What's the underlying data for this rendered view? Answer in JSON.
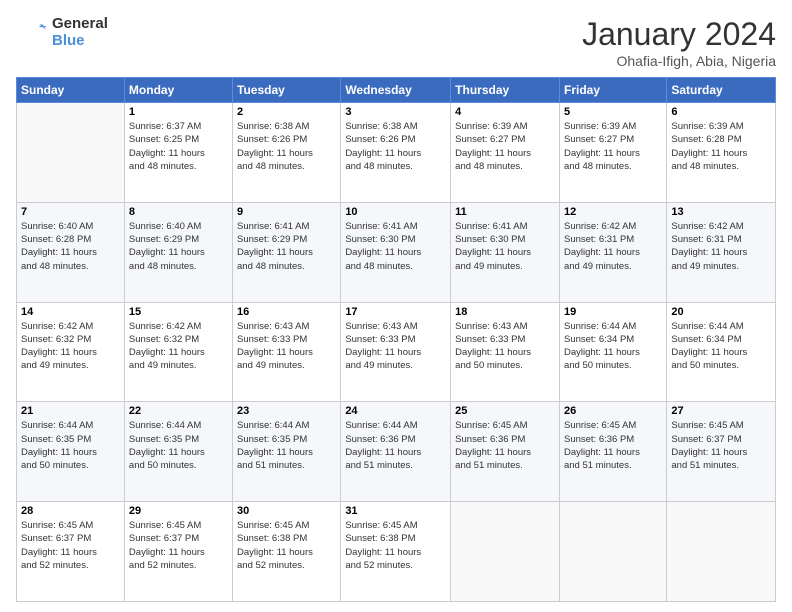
{
  "logo": {
    "text1": "General",
    "text2": "Blue"
  },
  "title": "January 2024",
  "subtitle": "Ohafia-Ifigh, Abia, Nigeria",
  "weekdays": [
    "Sunday",
    "Monday",
    "Tuesday",
    "Wednesday",
    "Thursday",
    "Friday",
    "Saturday"
  ],
  "weeks": [
    [
      {
        "day": "",
        "info": ""
      },
      {
        "day": "1",
        "info": "Sunrise: 6:37 AM\nSunset: 6:25 PM\nDaylight: 11 hours\nand 48 minutes."
      },
      {
        "day": "2",
        "info": "Sunrise: 6:38 AM\nSunset: 6:26 PM\nDaylight: 11 hours\nand 48 minutes."
      },
      {
        "day": "3",
        "info": "Sunrise: 6:38 AM\nSunset: 6:26 PM\nDaylight: 11 hours\nand 48 minutes."
      },
      {
        "day": "4",
        "info": "Sunrise: 6:39 AM\nSunset: 6:27 PM\nDaylight: 11 hours\nand 48 minutes."
      },
      {
        "day": "5",
        "info": "Sunrise: 6:39 AM\nSunset: 6:27 PM\nDaylight: 11 hours\nand 48 minutes."
      },
      {
        "day": "6",
        "info": "Sunrise: 6:39 AM\nSunset: 6:28 PM\nDaylight: 11 hours\nand 48 minutes."
      }
    ],
    [
      {
        "day": "7",
        "info": "Sunrise: 6:40 AM\nSunset: 6:28 PM\nDaylight: 11 hours\nand 48 minutes."
      },
      {
        "day": "8",
        "info": "Sunrise: 6:40 AM\nSunset: 6:29 PM\nDaylight: 11 hours\nand 48 minutes."
      },
      {
        "day": "9",
        "info": "Sunrise: 6:41 AM\nSunset: 6:29 PM\nDaylight: 11 hours\nand 48 minutes."
      },
      {
        "day": "10",
        "info": "Sunrise: 6:41 AM\nSunset: 6:30 PM\nDaylight: 11 hours\nand 48 minutes."
      },
      {
        "day": "11",
        "info": "Sunrise: 6:41 AM\nSunset: 6:30 PM\nDaylight: 11 hours\nand 49 minutes."
      },
      {
        "day": "12",
        "info": "Sunrise: 6:42 AM\nSunset: 6:31 PM\nDaylight: 11 hours\nand 49 minutes."
      },
      {
        "day": "13",
        "info": "Sunrise: 6:42 AM\nSunset: 6:31 PM\nDaylight: 11 hours\nand 49 minutes."
      }
    ],
    [
      {
        "day": "14",
        "info": "Sunrise: 6:42 AM\nSunset: 6:32 PM\nDaylight: 11 hours\nand 49 minutes."
      },
      {
        "day": "15",
        "info": "Sunrise: 6:42 AM\nSunset: 6:32 PM\nDaylight: 11 hours\nand 49 minutes."
      },
      {
        "day": "16",
        "info": "Sunrise: 6:43 AM\nSunset: 6:33 PM\nDaylight: 11 hours\nand 49 minutes."
      },
      {
        "day": "17",
        "info": "Sunrise: 6:43 AM\nSunset: 6:33 PM\nDaylight: 11 hours\nand 49 minutes."
      },
      {
        "day": "18",
        "info": "Sunrise: 6:43 AM\nSunset: 6:33 PM\nDaylight: 11 hours\nand 50 minutes."
      },
      {
        "day": "19",
        "info": "Sunrise: 6:44 AM\nSunset: 6:34 PM\nDaylight: 11 hours\nand 50 minutes."
      },
      {
        "day": "20",
        "info": "Sunrise: 6:44 AM\nSunset: 6:34 PM\nDaylight: 11 hours\nand 50 minutes."
      }
    ],
    [
      {
        "day": "21",
        "info": "Sunrise: 6:44 AM\nSunset: 6:35 PM\nDaylight: 11 hours\nand 50 minutes."
      },
      {
        "day": "22",
        "info": "Sunrise: 6:44 AM\nSunset: 6:35 PM\nDaylight: 11 hours\nand 50 minutes."
      },
      {
        "day": "23",
        "info": "Sunrise: 6:44 AM\nSunset: 6:35 PM\nDaylight: 11 hours\nand 51 minutes."
      },
      {
        "day": "24",
        "info": "Sunrise: 6:44 AM\nSunset: 6:36 PM\nDaylight: 11 hours\nand 51 minutes."
      },
      {
        "day": "25",
        "info": "Sunrise: 6:45 AM\nSunset: 6:36 PM\nDaylight: 11 hours\nand 51 minutes."
      },
      {
        "day": "26",
        "info": "Sunrise: 6:45 AM\nSunset: 6:36 PM\nDaylight: 11 hours\nand 51 minutes."
      },
      {
        "day": "27",
        "info": "Sunrise: 6:45 AM\nSunset: 6:37 PM\nDaylight: 11 hours\nand 51 minutes."
      }
    ],
    [
      {
        "day": "28",
        "info": "Sunrise: 6:45 AM\nSunset: 6:37 PM\nDaylight: 11 hours\nand 52 minutes."
      },
      {
        "day": "29",
        "info": "Sunrise: 6:45 AM\nSunset: 6:37 PM\nDaylight: 11 hours\nand 52 minutes."
      },
      {
        "day": "30",
        "info": "Sunrise: 6:45 AM\nSunset: 6:38 PM\nDaylight: 11 hours\nand 52 minutes."
      },
      {
        "day": "31",
        "info": "Sunrise: 6:45 AM\nSunset: 6:38 PM\nDaylight: 11 hours\nand 52 minutes."
      },
      {
        "day": "",
        "info": ""
      },
      {
        "day": "",
        "info": ""
      },
      {
        "day": "",
        "info": ""
      }
    ]
  ]
}
